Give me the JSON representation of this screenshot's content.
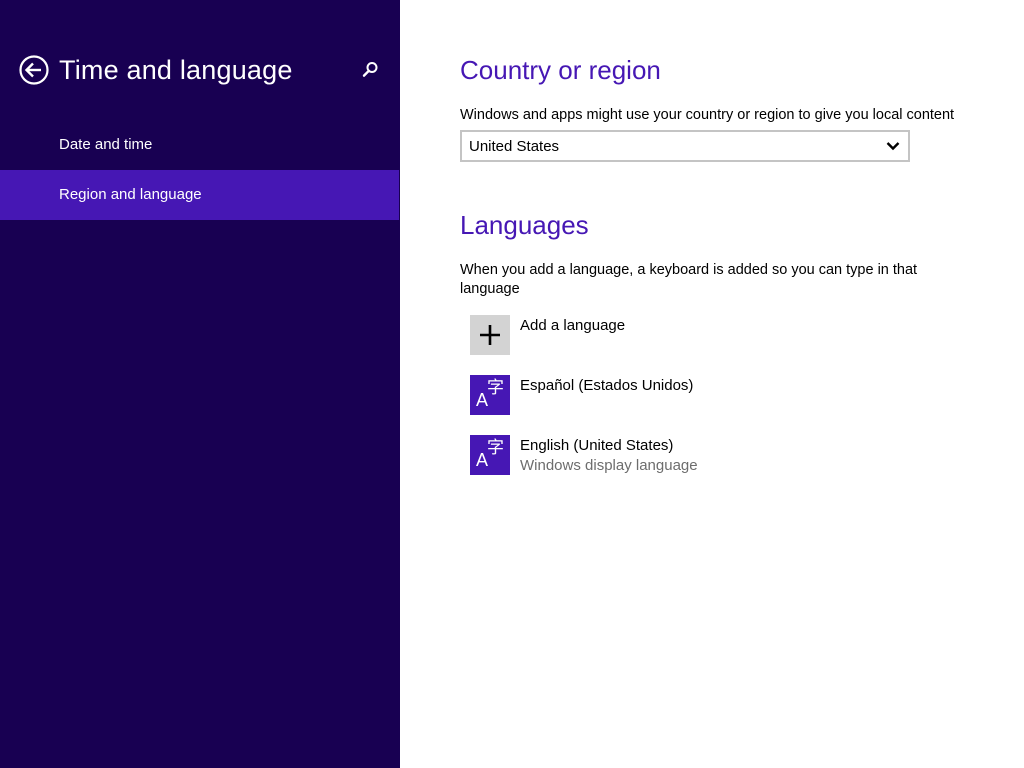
{
  "sidebar": {
    "title": "Time and language",
    "items": [
      {
        "label": "Date and time",
        "selected": false
      },
      {
        "label": "Region and language",
        "selected": true
      }
    ]
  },
  "country": {
    "heading": "Country or region",
    "description": "Windows and apps might use your country or region to give you local content",
    "selected_value": "United States"
  },
  "languages": {
    "heading": "Languages",
    "description_line1": "When you add a language, a keyboard is added so you can type in that",
    "description_line2": "language",
    "add_label": "Add a language",
    "add_icon_glyph": "+",
    "lang_icon_glyph_latin": "A",
    "lang_icon_glyph_cjk": "字",
    "items": [
      {
        "name": "Español (Estados Unidos)",
        "subtitle": ""
      },
      {
        "name": "English (United States)",
        "subtitle": "Windows display language"
      }
    ]
  },
  "icons": {
    "back": "back-arrow-icon",
    "search": "search-icon",
    "chevron": "chevron-down-icon",
    "add": "plus-icon",
    "language": "language-icon"
  },
  "colors": {
    "sidebar_bg": "#180052",
    "accent": "#4617b4",
    "selected_item_bg": "#4617b4",
    "add_tile_bg": "#d3d3d3",
    "subtitle_text": "#6d6d6d"
  }
}
